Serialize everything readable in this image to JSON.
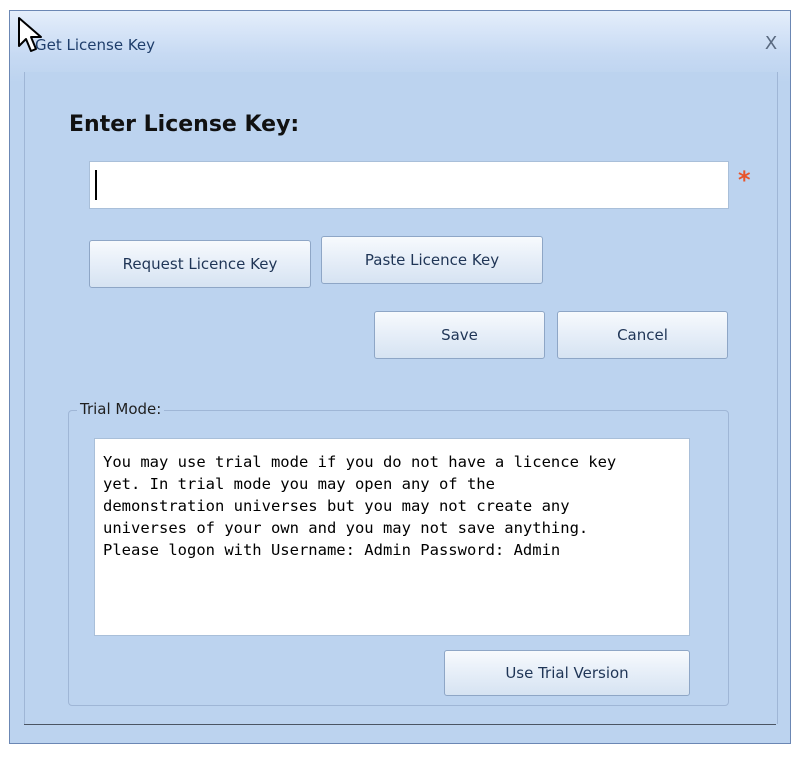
{
  "window": {
    "title": "Get License Key",
    "close_glyph": "X"
  },
  "form": {
    "heading": "Enter License Key:",
    "key_value": "",
    "required_mark": "*"
  },
  "buttons": {
    "request": "Request Licence Key",
    "paste": "Paste Licence Key",
    "save": "Save",
    "cancel": "Cancel"
  },
  "trial": {
    "group_label": "Trial Mode:",
    "text": "You may use trial mode if you do not have a licence key\nyet. In trial mode you may open any of the\ndemonstration universes but you may not create any\nuniverses of your own and you may not save anything.\nPlease logon with Username: Admin Password: Admin",
    "button": "Use Trial Version"
  },
  "colors": {
    "window_background": "#bcd3ef",
    "required_mark": "#e8542b"
  },
  "icons": {
    "pointer": "mouse-pointer-icon",
    "close": "close-icon"
  }
}
